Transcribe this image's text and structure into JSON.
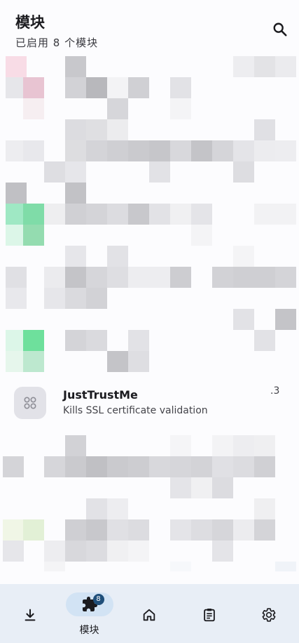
{
  "header": {
    "title": "模块",
    "subtitle": "已启用 8 个模块",
    "search_icon": "search-icon"
  },
  "modules": [
    {
      "name": "JustTrustMe",
      "description": "Kills SSL certificate validation",
      "version": ".3",
      "icon": "puzzle-dots-icon"
    }
  ],
  "bottom_nav": {
    "items": [
      {
        "id": "download",
        "icon": "download-icon",
        "label": ""
      },
      {
        "id": "modules",
        "icon": "puzzle-icon",
        "label": "模块",
        "badge": "8",
        "active": true
      },
      {
        "id": "home",
        "icon": "home-icon",
        "label": ""
      },
      {
        "id": "logs",
        "icon": "clipboard-icon",
        "label": ""
      },
      {
        "id": "settings",
        "icon": "gear-icon",
        "label": ""
      }
    ]
  },
  "colors": {
    "background": "#fcfcfe",
    "nav_background": "#e8eef6",
    "active_pill": "#d2e3f4",
    "badge": "#1f4f7a"
  }
}
